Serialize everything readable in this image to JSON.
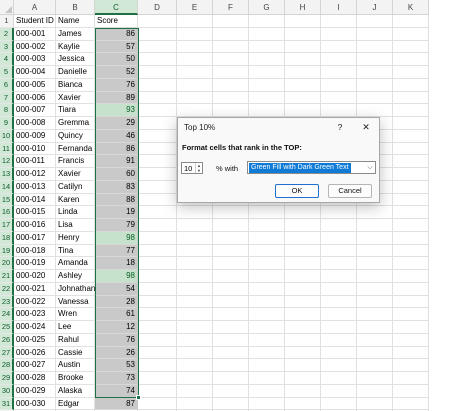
{
  "columns": [
    "A",
    "B",
    "C",
    "D",
    "E",
    "F",
    "G",
    "H",
    "I",
    "J",
    "K"
  ],
  "selected_column": "C",
  "header_row": {
    "a": "Student ID",
    "b": "Name",
    "c": "Score"
  },
  "rows": [
    {
      "id": "000-001",
      "name": "James",
      "score": "86",
      "top": false
    },
    {
      "id": "000-002",
      "name": "Kaylie",
      "score": "57",
      "top": false
    },
    {
      "id": "000-003",
      "name": "Jessica",
      "score": "50",
      "top": false
    },
    {
      "id": "000-004",
      "name": "Danielle",
      "score": "52",
      "top": false
    },
    {
      "id": "000-005",
      "name": "Bianca",
      "score": "76",
      "top": false
    },
    {
      "id": "000-006",
      "name": "Xavier",
      "score": "89",
      "top": false
    },
    {
      "id": "000-007",
      "name": "Tiara",
      "score": "93",
      "top": true
    },
    {
      "id": "000-008",
      "name": "Gremma",
      "score": "29",
      "top": false
    },
    {
      "id": "000-009",
      "name": "Quincy",
      "score": "46",
      "top": false
    },
    {
      "id": "000-010",
      "name": "Fernanda",
      "score": "86",
      "top": false
    },
    {
      "id": "000-011",
      "name": "Francis",
      "score": "91",
      "top": false
    },
    {
      "id": "000-012",
      "name": "Xavier",
      "score": "60",
      "top": false
    },
    {
      "id": "000-013",
      "name": "Catilyn",
      "score": "83",
      "top": false
    },
    {
      "id": "000-014",
      "name": "Karen",
      "score": "88",
      "top": false
    },
    {
      "id": "000-015",
      "name": "Linda",
      "score": "19",
      "top": false
    },
    {
      "id": "000-016",
      "name": "Lisa",
      "score": "79",
      "top": false
    },
    {
      "id": "000-017",
      "name": "Henry",
      "score": "98",
      "top": true
    },
    {
      "id": "000-018",
      "name": "Tina",
      "score": "77",
      "top": false
    },
    {
      "id": "000-019",
      "name": "Amanda",
      "score": "18",
      "top": false
    },
    {
      "id": "000-020",
      "name": "Ashley",
      "score": "98",
      "top": true
    },
    {
      "id": "000-021",
      "name": "Johnathan",
      "score": "54",
      "top": false
    },
    {
      "id": "000-022",
      "name": "Vanessa",
      "score": "28",
      "top": false
    },
    {
      "id": "000-023",
      "name": "Wren",
      "score": "61",
      "top": false
    },
    {
      "id": "000-024",
      "name": "Lee",
      "score": "12",
      "top": false
    },
    {
      "id": "000-025",
      "name": "Rahul",
      "score": "76",
      "top": false
    },
    {
      "id": "000-026",
      "name": "Cassie",
      "score": "26",
      "top": false
    },
    {
      "id": "000-027",
      "name": "Austin",
      "score": "53",
      "top": false
    },
    {
      "id": "000-028",
      "name": "Brooke",
      "score": "73",
      "top": false
    },
    {
      "id": "000-029",
      "name": "Alaska",
      "score": "74",
      "top": false
    },
    {
      "id": "000-030",
      "name": "Edgar",
      "score": "87",
      "top": false
    }
  ],
  "row_numbers": [
    "1",
    "2",
    "3",
    "4",
    "5",
    "6",
    "7",
    "8",
    "9",
    "10",
    "11",
    "12",
    "13",
    "14",
    "15",
    "16",
    "17",
    "18",
    "19",
    "20",
    "21",
    "22",
    "23",
    "24",
    "25",
    "26",
    "27",
    "28",
    "29",
    "30",
    "31",
    "32"
  ],
  "dialog": {
    "title": "Top 10%",
    "help": "?",
    "close": "✕",
    "label": "Format cells that rank in the TOP:",
    "value": "10",
    "with_label": "% with",
    "format_option": "Green Fill with Dark Green Text",
    "ok_label": "OK",
    "cancel_label": "Cancel"
  },
  "colors": {
    "selection": "#1e7145",
    "score_fill": "#c9c9c9",
    "top_fill": "#c6e2cc",
    "top_text": "#0b6125",
    "highlight": "#0f7bd6"
  }
}
